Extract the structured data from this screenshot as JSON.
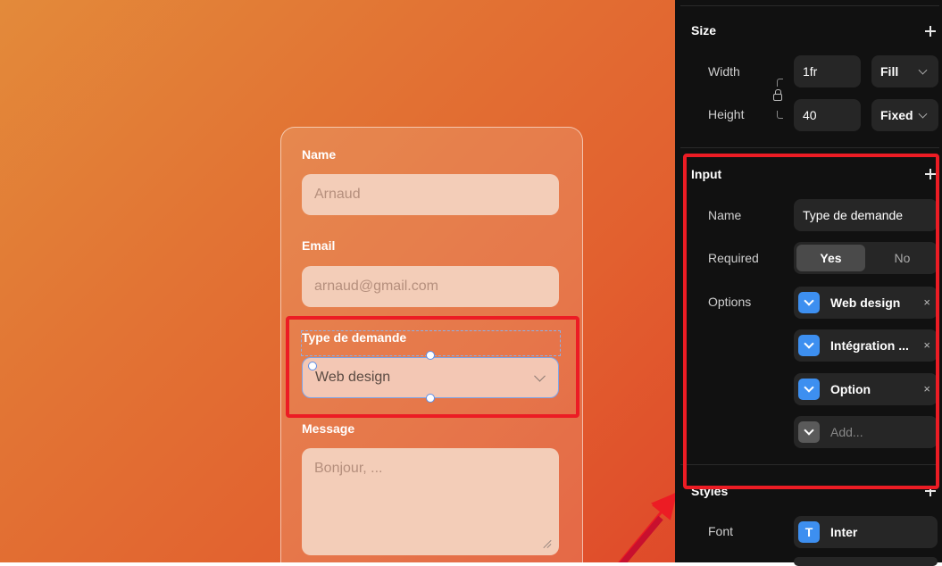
{
  "form": {
    "name_label": "Name",
    "name_placeholder": "Arnaud",
    "email_label": "Email",
    "email_placeholder": "arnaud@gmail.com",
    "type_label": "Type de demande",
    "type_value": "Web design",
    "message_label": "Message",
    "message_placeholder": "Bonjour, ..."
  },
  "panel": {
    "size": {
      "title": "Size",
      "width_label": "Width",
      "width_value": "1fr",
      "width_mode": "Fill",
      "height_label": "Height",
      "height_value": "40",
      "height_mode": "Fixed"
    },
    "input": {
      "title": "Input",
      "name_label": "Name",
      "name_value": "Type de demande",
      "required_label": "Required",
      "required_yes": "Yes",
      "required_no": "No",
      "required_selected": "Yes",
      "options_label": "Options",
      "options": [
        "Web design",
        "Intégration ...",
        "Option"
      ],
      "add_placeholder": "Add...",
      "remove_symbol": "×"
    },
    "styles": {
      "title": "Styles",
      "font_label": "Font",
      "font_value": "Inter",
      "font_icon_glyph": "T"
    }
  },
  "icons": [
    "plus-icon",
    "chevron-down-icon",
    "lock-icon",
    "close-icon",
    "font-icon",
    "resize-handle-icon"
  ],
  "colors": {
    "canvas_gradient_start": "#e38a3a",
    "canvas_gradient_end": "#df4a2a",
    "panel_background": "#111111",
    "accent_blue": "#3d8ff0",
    "highlight_red": "#ec1c24"
  }
}
